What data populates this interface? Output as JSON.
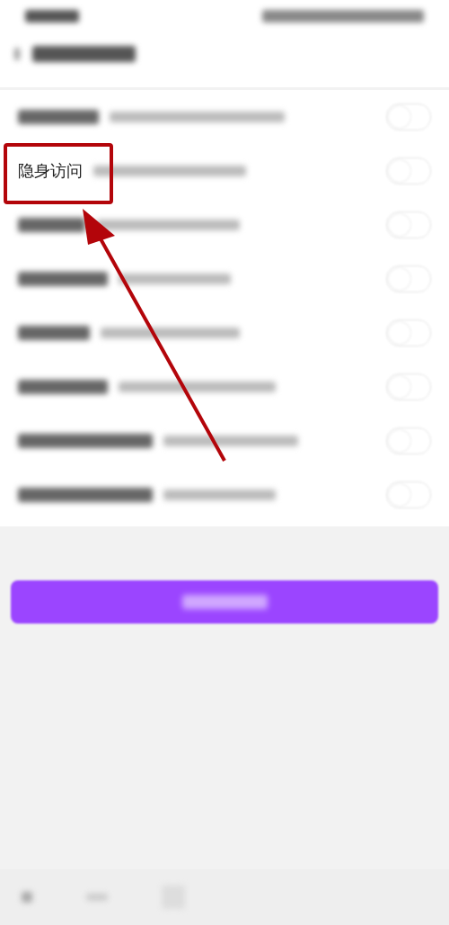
{
  "settings": [
    {
      "kind": "blurred",
      "on": false,
      "highlighted": false
    },
    {
      "kind": "text",
      "label": "隐身访问",
      "on": false,
      "highlighted": true
    },
    {
      "kind": "blurred",
      "on": false,
      "highlighted": false
    },
    {
      "kind": "blurred",
      "on": false,
      "highlighted": false
    },
    {
      "kind": "blurred",
      "on": false,
      "highlighted": false
    },
    {
      "kind": "blurred",
      "on": false,
      "highlighted": false
    },
    {
      "kind": "blurred",
      "on": false,
      "highlighted": false
    },
    {
      "kind": "blurred",
      "on": false,
      "highlighted": false
    }
  ]
}
